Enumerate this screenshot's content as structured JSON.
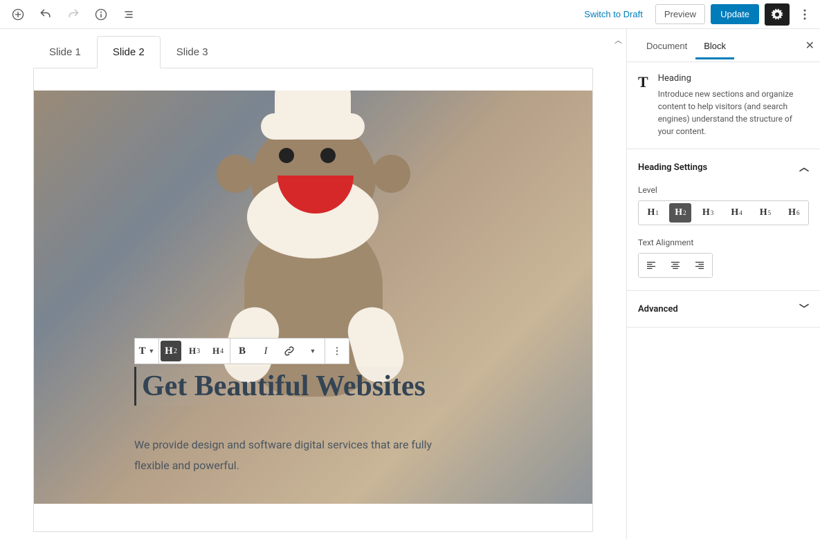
{
  "toolbar": {
    "switch_draft": "Switch to Draft",
    "preview": "Preview",
    "update": "Update"
  },
  "slides": {
    "tabs": [
      "Slide 1",
      "Slide 2",
      "Slide 3"
    ],
    "active_index": 1
  },
  "block_toolbar": {
    "h2": "H2",
    "h3": "H3",
    "h4": "H4"
  },
  "content": {
    "heading": "Get Beautiful Websites",
    "paragraph": "We provide design and software digital services that are fully flexible and powerful."
  },
  "sidebar": {
    "tabs": {
      "document": "Document",
      "block": "Block"
    },
    "block_info": {
      "title": "Heading",
      "desc": "Introduce new sections and organize content to help visitors (and search engines) understand the structure of your content."
    },
    "panel_heading": "Heading Settings",
    "label_level": "Level",
    "levels": [
      "H1",
      "H2",
      "H3",
      "H4",
      "H5",
      "H6"
    ],
    "active_level": "H2",
    "label_align": "Text Alignment",
    "panel_advanced": "Advanced"
  }
}
